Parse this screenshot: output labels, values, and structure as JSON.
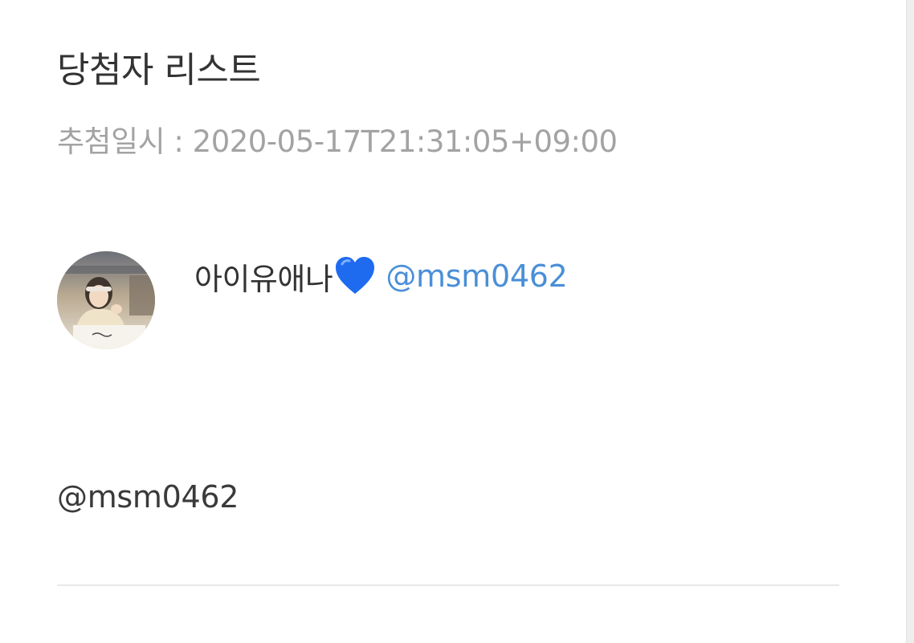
{
  "page": {
    "title": "당첨자 리스트",
    "draw_date": "추첨일시 : 2020-05-17T21:31:05+09:00"
  },
  "winners": [
    {
      "display_name": "아이유애나",
      "name_emoji_icon": "blue-heart-icon",
      "handle": "@msm0462",
      "comment": "@msm0462"
    }
  ],
  "colors": {
    "title": "#333333",
    "muted_text": "#a3a3a3",
    "handle_link": "#4a8fd8",
    "heart": "#1e6bf0",
    "divider": "#e8e8e8"
  }
}
